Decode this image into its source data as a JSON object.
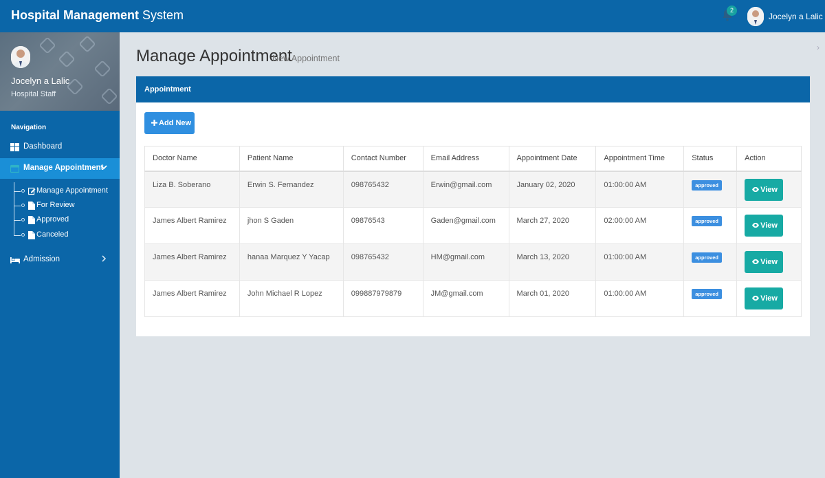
{
  "app": {
    "title_bold": "Hospital Management",
    "title_rest": " System"
  },
  "header": {
    "notification_count": "2",
    "user_name": "Jocelyn a Lalic"
  },
  "sidebar": {
    "profile": {
      "name": "Jocelyn a Lalic",
      "role": "Hospital Staff"
    },
    "nav_title": "Navigation",
    "items": [
      {
        "label": "Dashboard",
        "icon": "dashboard-icon"
      },
      {
        "label": "Manage Appointment",
        "icon": "calendar-icon",
        "active": true
      },
      {
        "label": "Admission",
        "icon": "bed-icon"
      }
    ],
    "subitems": [
      {
        "label": "Manage Appointment",
        "icon": "edit-icon"
      },
      {
        "label": "For Review",
        "icon": "file-icon"
      },
      {
        "label": "Approved",
        "icon": "file-icon"
      },
      {
        "label": "Canceled",
        "icon": "file-icon"
      }
    ]
  },
  "main": {
    "title": "Manage Appointment",
    "subtitle": "New Appointment",
    "panel_title": "Appointment",
    "add_button": "Add New",
    "table": {
      "headers": [
        "Doctor Name",
        "Patient Name",
        "Contact Number",
        "Email Address",
        "Appointment Date",
        "Appointment Time",
        "Status",
        "Action"
      ],
      "rows": [
        [
          "Liza B. Soberano",
          "Erwin S. Fernandez",
          "098765432",
          "Erwin@gmail.com",
          "January 02, 2020",
          "01:00:00 AM",
          "approved",
          "View"
        ],
        [
          "James Albert Ramirez",
          "jhon S Gaden",
          "09876543",
          "Gaden@gmail.com",
          "March 27, 2020",
          "02:00:00 AM",
          "approved",
          "View"
        ],
        [
          "James Albert Ramirez",
          "hanaa Marquez Y Yacap",
          "098765432",
          "HM@gmail.com",
          "March 13, 2020",
          "01:00:00 AM",
          "approved",
          "View"
        ],
        [
          "James Albert Ramirez",
          "John Michael R Lopez",
          "099887979879",
          "JM@gmail.com",
          "March 01, 2020",
          "01:00:00 AM",
          "approved",
          "View"
        ]
      ]
    }
  },
  "colors": {
    "primary": "#0b66a8",
    "active_nav": "#1a8fd7",
    "add_button": "#2f8fe0",
    "view_button": "#17aaa4",
    "status_badge": "#3c8fe0"
  }
}
